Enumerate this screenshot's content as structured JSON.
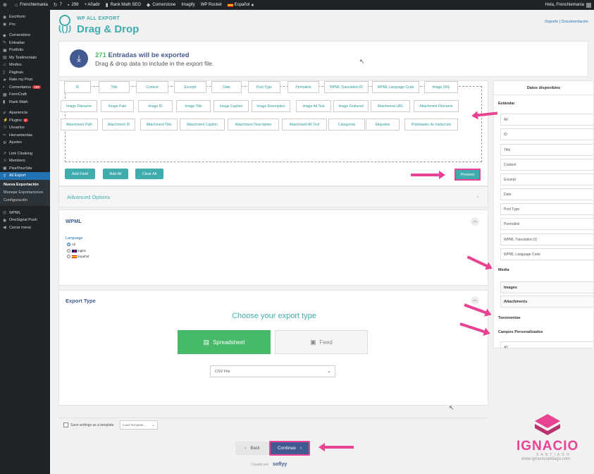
{
  "admin_bar": {
    "site": "Frenchiemania",
    "updates": "7",
    "comments": "299",
    "add_new": "+ Añadir",
    "rankmath": "Rank Math SEO",
    "cornerstone": "Cornerstone",
    "imagify": "Imagify",
    "wprocket": "WP Rocket",
    "language": "Español",
    "greeting": "Hola, Frenchiemania"
  },
  "sidebar": {
    "items": [
      {
        "label": "Escritorio"
      },
      {
        "label": "Pro"
      },
      {
        "label": "Cornerstone"
      },
      {
        "label": "Entradas"
      },
      {
        "label": "Portfolio"
      },
      {
        "label": "My Testimonials"
      },
      {
        "label": "Medios"
      },
      {
        "label": "Páginas"
      },
      {
        "label": "Rate my Post"
      },
      {
        "label": "Comentarios",
        "badge": "299"
      },
      {
        "label": "FormCraft"
      },
      {
        "label": "Rank Math"
      },
      {
        "label": "Apariencia"
      },
      {
        "label": "Plugins",
        "badge": "6"
      },
      {
        "label": "Usuarios"
      },
      {
        "label": "Herramientas"
      },
      {
        "label": "Ajustes"
      },
      {
        "label": "Link Cloaking"
      },
      {
        "label": "Members"
      },
      {
        "label": "PixelYourSite"
      },
      {
        "label": "All Export"
      },
      {
        "label": "WPML"
      },
      {
        "label": "OneSignal Push"
      },
      {
        "label": "Cerrar menú"
      }
    ],
    "submenu": [
      "Nueva Exportación",
      "Manejar Exportaciones",
      "Configuración"
    ]
  },
  "header": {
    "small_title": "WP ALL EXPORT",
    "title": "Drag & Drop",
    "links": "Soporte | Documentación"
  },
  "count": {
    "number": "271",
    "line1_rest": "Entradas will be exported",
    "line2": "Drag & drop data to include in the export file."
  },
  "chips": [
    "ID",
    "Title",
    "Content",
    "Excerpt",
    "Date",
    "Post Type",
    "Permalink",
    "WPML Translation ID",
    "WPML Language Code",
    "Image URL",
    "Image Filename",
    "Image Path",
    "Image ID",
    "Image Title",
    "Image Caption",
    "Image Description",
    "Image Alt Text",
    "Image Featured",
    "Attachment URL",
    "Attachment Filename",
    "Attachment Path",
    "Attachment ID",
    "Attachment Title",
    "Attachment Caption",
    "Attachment Description",
    "Attachment Alt Text",
    "Categorías",
    "Etiquetas",
    "Prioridades de traducción"
  ],
  "buttons": {
    "add_field": "Add Field",
    "add_all": "Add All",
    "clear_all": "Clear All",
    "preview": "Preview"
  },
  "advanced": {
    "label": "Advanced Options"
  },
  "wpml": {
    "title": "WPML",
    "language_label": "Language",
    "options": [
      "All",
      "Inglés",
      "Español"
    ]
  },
  "export_type": {
    "title": "Export Type",
    "choose": "Choose your export type",
    "spreadsheet": "Spreadsheet",
    "feed": "Feed",
    "format": "CSV File"
  },
  "save": {
    "label": "Save settings as a template",
    "template_placeholder": "Load Template..."
  },
  "nav": {
    "back": "Back",
    "continue": "Continue"
  },
  "credit": {
    "prefix": "Creado por",
    "brand": "soflyy"
  },
  "right_panel": {
    "header": "Datos disponibles",
    "standard_title": "Estándar",
    "standard_items": [
      "All",
      "ID",
      "Title",
      "Content",
      "Excerpt",
      "Date",
      "Post Type",
      "Permalink",
      "WPML Translation ID",
      "WPML Language Code"
    ],
    "media_title": "Media",
    "media_items": [
      "Images",
      "Attachments"
    ],
    "taxonomies_title": "Taxonomías",
    "custom_title": "Campos Personalizados",
    "custom_items": [
      "All"
    ]
  },
  "watermark": {
    "name": "IGNACIO",
    "sub": "SANTIAGO",
    "url": "www.ignaciosantiago.com"
  },
  "colors": {
    "teal": "#40acad",
    "navy": "#425a91",
    "green": "#46ba69",
    "pink": "#e84393",
    "wp_dark": "#1d2327",
    "wp_blue": "#2271b1"
  }
}
